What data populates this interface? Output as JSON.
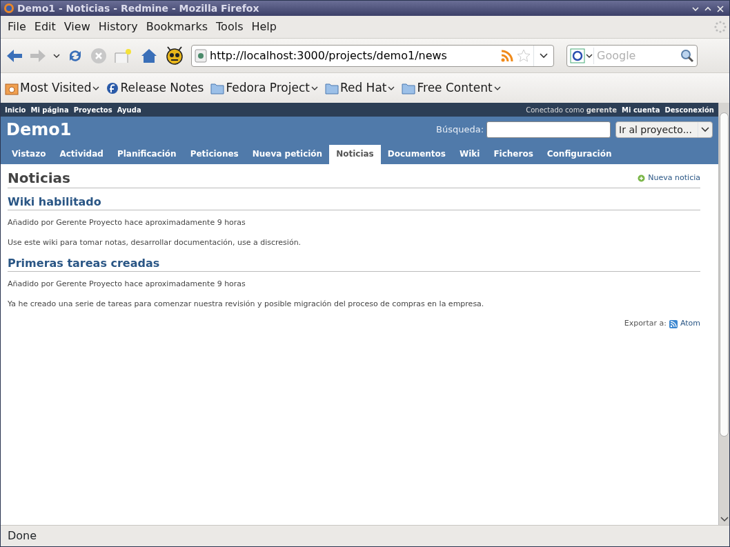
{
  "window": {
    "title": "Demo1 - Noticias - Redmine - Mozilla Firefox"
  },
  "menu_bar": [
    "File",
    "Edit",
    "View",
    "History",
    "Bookmarks",
    "Tools",
    "Help"
  ],
  "address_bar": {
    "value": "http://localhost:3000/projects/demo1/news"
  },
  "search_bar": {
    "placeholder": "Google"
  },
  "bookmarks": [
    {
      "label": "Most Visited",
      "kind": "history",
      "dropdown": true
    },
    {
      "label": "Release Notes",
      "kind": "fedora",
      "dropdown": false
    },
    {
      "label": "Fedora Project",
      "kind": "folder",
      "dropdown": true
    },
    {
      "label": "Red Hat",
      "kind": "folder",
      "dropdown": true
    },
    {
      "label": "Free Content",
      "kind": "folder",
      "dropdown": true
    }
  ],
  "top_menu": {
    "left": [
      "Inicio",
      "Mi página",
      "Proyectos",
      "Ayuda"
    ],
    "logged_in": "Conectado como **gerente**",
    "right": [
      "Mi cuenta",
      "Desconexión"
    ]
  },
  "header": {
    "project": "Demo1",
    "search_label": "Búsqueda:",
    "jump_select": "Ir al proyecto..."
  },
  "tabs": [
    {
      "label": "Vistazo",
      "selected": false
    },
    {
      "label": "Actividad",
      "selected": false
    },
    {
      "label": "Planificación",
      "selected": false
    },
    {
      "label": "Peticiones",
      "selected": false
    },
    {
      "label": "Nueva petición",
      "selected": false
    },
    {
      "label": "Noticias",
      "selected": true
    },
    {
      "label": "Documentos",
      "selected": false
    },
    {
      "label": "Wiki",
      "selected": false
    },
    {
      "label": "Ficheros",
      "selected": false
    },
    {
      "label": "Configuración",
      "selected": false
    }
  ],
  "content": {
    "title": "Noticias",
    "new_link": "Nueva noticia",
    "news": [
      {
        "title": "Wiki habilitado",
        "added_by": "Añadido por",
        "author": "Gerente Proyecto",
        "ago": "hace",
        "time": "aproximadamente 9 horas",
        "summary": "Use este wiki para tomar notas, desarrollar documentación, use a discresión."
      },
      {
        "title": "Primeras tareas creadas",
        "added_by": "Añadido por",
        "author": "Gerente Proyecto",
        "ago": "hace",
        "time": "aproximadamente 9 horas",
        "summary": "Ya he creado una serie de tareas para comenzar nuestra revisión y posible migración del proceso de compras en la empresa."
      }
    ],
    "export_label": "Exportar a:",
    "export_link": "Atom"
  },
  "status_bar": "Done"
}
